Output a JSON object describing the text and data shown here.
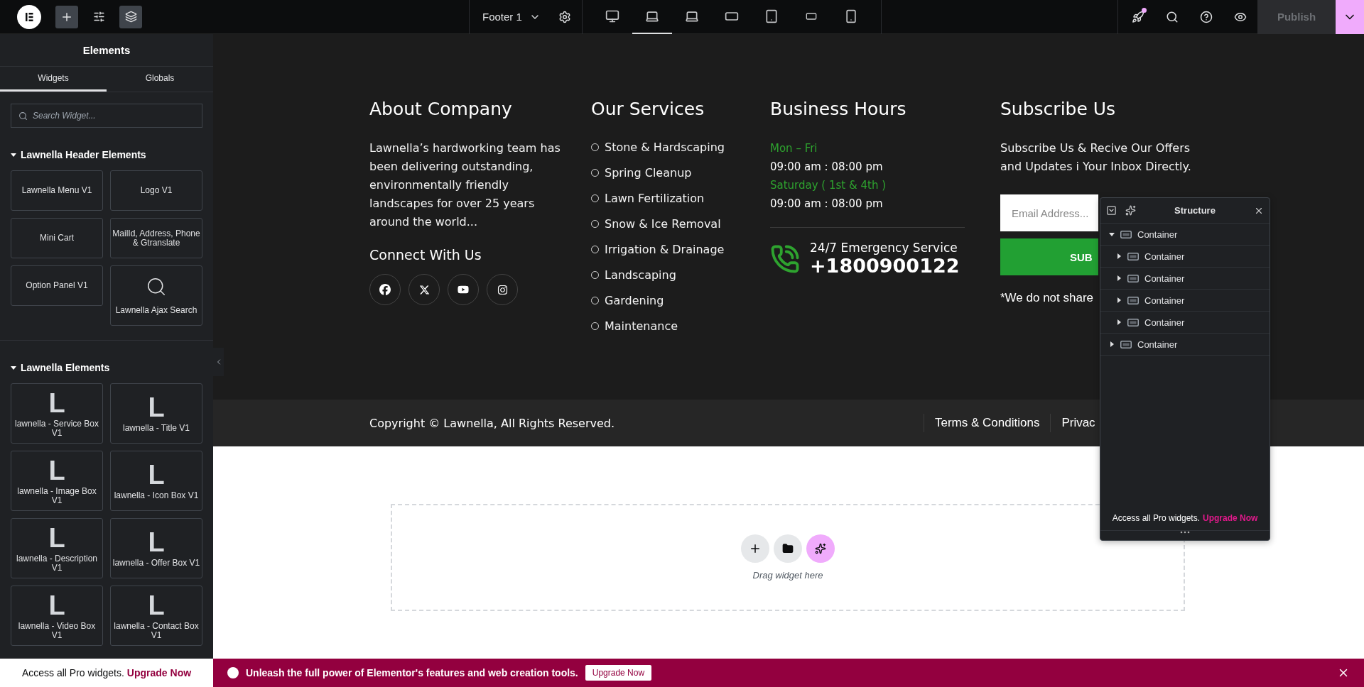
{
  "topbar": {
    "add_active": true,
    "layers_active": true,
    "document": "Footer 1",
    "devices": [
      {
        "kind": "desktop",
        "selected": false
      },
      {
        "kind": "laptop",
        "selected": true
      },
      {
        "kind": "laptop",
        "selected": false
      },
      {
        "kind": "tablet-wide",
        "selected": false
      },
      {
        "kind": "tablet",
        "selected": false
      },
      {
        "kind": "phone-wide",
        "selected": false
      },
      {
        "kind": "phone",
        "selected": false
      }
    ],
    "publish": {
      "label": "Publish",
      "disabled": true
    }
  },
  "panel": {
    "title": "Elements",
    "tabs": [
      {
        "label": "Widgets",
        "selected": true
      },
      {
        "label": "Globals",
        "selected": false
      }
    ],
    "search": {
      "placeholder": "Search Widget..."
    },
    "sections": [
      {
        "title": "Lawnella Header Elements",
        "expanded": true,
        "widgets": [
          {
            "label": "Lawnella Menu V1",
            "kind": "plain"
          },
          {
            "label": "Logo V1",
            "kind": "plain"
          },
          {
            "label": "Mini Cart",
            "kind": "plain"
          },
          {
            "label": "MailId, Address, Phone & Gtranslate",
            "kind": "plain"
          },
          {
            "label": "Option Panel V1",
            "kind": "plain"
          },
          {
            "label": "Lawnella Ajax Search",
            "kind": "search"
          }
        ]
      },
      {
        "title": "Lawnella Elements",
        "expanded": true,
        "widgets": [
          {
            "label": "lawnella - Service Box V1",
            "kind": "letter",
            "glyph": "L"
          },
          {
            "label": "lawnella - Title V1",
            "kind": "letter",
            "glyph": "L"
          },
          {
            "label": "lawnella - Image Box V1",
            "kind": "letter",
            "glyph": "L"
          },
          {
            "label": "lawnella - Icon Box V1",
            "kind": "letter",
            "glyph": "L"
          },
          {
            "label": "lawnella - Description V1",
            "kind": "letter",
            "glyph": "L"
          },
          {
            "label": "lawnella - Offer Box V1",
            "kind": "letter",
            "glyph": "L"
          },
          {
            "label": "lawnella - Video Box V1",
            "kind": "letter",
            "glyph": "L"
          },
          {
            "label": "lawnella - Contact Box V1",
            "kind": "letter",
            "glyph": "L"
          }
        ]
      }
    ],
    "promo": {
      "text": "Access all Pro widgets.",
      "link": "Upgrade Now"
    }
  },
  "footer": {
    "about": {
      "heading": "About Company",
      "text": "Lawnella’s hardworking team has been delivering outstanding, environmentally friendly landscapes for over 25 years around the world...",
      "connect": "Connect With Us",
      "socials": [
        {
          "kind": "facebook"
        },
        {
          "kind": "x"
        },
        {
          "kind": "youtube"
        },
        {
          "kind": "instagram"
        }
      ]
    },
    "services": {
      "heading": "Our Services",
      "items": [
        "Stone & Hardscaping",
        "Spring Cleanup",
        "Lawn Fertilization",
        "Snow & Ice Removal",
        "Irrigation & Drainage",
        "Landscaping",
        "Gardening",
        "Maintenance"
      ]
    },
    "hours": {
      "heading": "Business Hours",
      "lines": [
        {
          "text": "Mon – Fri",
          "kind": "day"
        },
        {
          "text": "09:00 am : 08:00 pm",
          "kind": "time"
        },
        {
          "text": "Saturday ( 1st & 4th )",
          "kind": "day"
        },
        {
          "text": "09:00 am : 08:00 pm",
          "kind": "time"
        }
      ],
      "emergency_label": "24/7 Emergency Service",
      "phone": "+1800900122"
    },
    "subscribe": {
      "heading": "Subscribe Us",
      "text": "Subscribe Us & Recive Our Offers and Updates i Your Inbox Directly.",
      "email_placeholder": "Email Address...",
      "button": "SUB",
      "note": "*We do not share"
    },
    "copyright": "Copyright © Lawnella, All Rights Reserved.",
    "links": [
      "Terms & Conditions",
      "Privac"
    ]
  },
  "dropzone": {
    "hint": "Drag widget here"
  },
  "banner": {
    "text": "Unleash the full power of Elementor's features and web creation tools.",
    "button": "Upgrade Now"
  },
  "structure": {
    "title": "Structure",
    "tree": [
      {
        "label": "Container",
        "expanded": true,
        "children": [
          {
            "label": "Container",
            "expanded": false
          },
          {
            "label": "Container",
            "expanded": false
          },
          {
            "label": "Container",
            "expanded": false
          },
          {
            "label": "Container",
            "expanded": false
          }
        ]
      },
      {
        "label": "Container",
        "expanded": false
      }
    ],
    "promo": {
      "text": "Access all Pro widgets.",
      "link": "Upgrade Now"
    }
  }
}
